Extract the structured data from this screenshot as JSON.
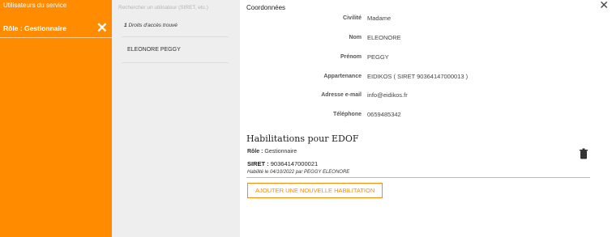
{
  "sidebar": {
    "service_title": "Utilisateurs du service",
    "role_label": "Rôle : Gestionnaire",
    "close_symbol": "✕",
    "accent_color": "#ff8c00"
  },
  "user_list": {
    "search_placeholder": "Rechercher un utilisateur (SIRET, etc.)",
    "result_count_number": "1",
    "result_count_text": "Droits d'accès trouvé",
    "users": [
      "ELEONORE PEGGY"
    ]
  },
  "details": {
    "close_symbol": "✕",
    "section_title": "Coordonnées",
    "fields": [
      {
        "label": "Civilité",
        "value": "Madame"
      },
      {
        "label": "Nom",
        "value": "ELEONORE"
      },
      {
        "label": "Prénom",
        "value": "PEGGY"
      },
      {
        "label": "Appartenance",
        "value": "EIDIKOS ( SIRET 90364147000013 )"
      },
      {
        "label": "Adresse e-mail",
        "value": "info@eidikos.fr"
      },
      {
        "label": "Téléphone",
        "value": "0659485342"
      }
    ],
    "habilitations": {
      "title": "Habilitations pour EDOF",
      "role_label": "Rôle :",
      "role_value": "Gestionnaire",
      "siret_label": "SIRET :",
      "siret_value": "90364147000021",
      "meta": "Habilité le 04/10/2022 par PEGGY ELEONORE",
      "trash_icon": "trash-icon",
      "add_button": "AJOUTER UNE NOUVELLE HABILITATION"
    }
  }
}
